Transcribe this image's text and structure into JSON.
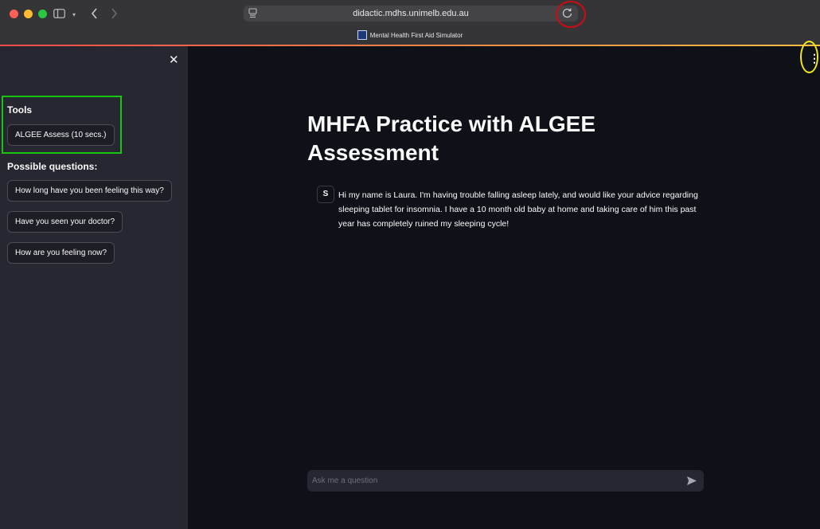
{
  "browser": {
    "url": "didactic.mdhs.unimelb.edu.au",
    "tab_title": "Mental Health First Aid Simulator"
  },
  "sidebar": {
    "tools_title": "Tools",
    "tools_button": "ALGEE Assess (10 secs.)",
    "questions_title": "Possible questions:",
    "questions": [
      "How long have you been feeling this way?",
      "Have you seen your doctor?",
      "How are you feeling now?"
    ]
  },
  "main": {
    "title": "MHFA Practice with ALGEE Assessment",
    "message": {
      "avatar": "S",
      "text": "Hi my name is Laura. I'm having trouble falling asleep lately, and would like your advice regarding sleeping tablet for insomnia. I have a 10 month old baby at home and taking care of him this past year has completely ruined my sleeping cycle!"
    },
    "input_placeholder": "Ask me a question"
  },
  "annotations": {
    "reload_highlight_color": "#d10a10",
    "tools_highlight_color": "#17c40f",
    "menu_highlight_color": "#f0e81a"
  },
  "icons": [
    "sidebar-toggle-icon",
    "back-icon",
    "forward-icon",
    "reload-icon",
    "download-icon",
    "share-icon",
    "new-tab-icon",
    "tabs-overview-icon",
    "close-icon",
    "kebab-menu-icon",
    "send-icon"
  ]
}
